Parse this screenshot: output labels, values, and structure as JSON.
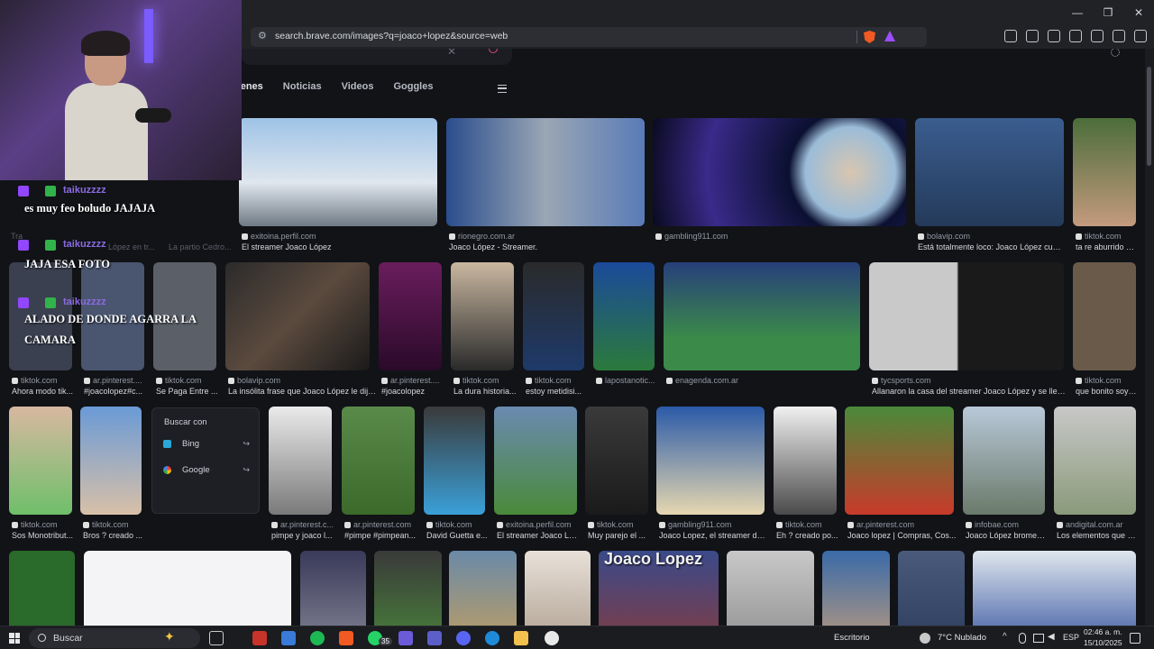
{
  "browser": {
    "url": "search.brave.com/images?q=joaco+lopez&source=web",
    "window_controls": [
      "—",
      "❐",
      "✕"
    ]
  },
  "search": {
    "tabs": [
      "genes",
      "Noticias",
      "Videos",
      "Goggles"
    ]
  },
  "results_row1": [
    {
      "source": "exitoina.perfil.com",
      "title": "El streamer Joaco López"
    },
    {
      "source": "rionegro.com.ar",
      "title": "Joaco López - Streamer."
    },
    {
      "source": "gambling911.com",
      "title": ""
    },
    {
      "source": "bolavip.com",
      "title": "Está totalmente loco: Joaco López cump..."
    },
    {
      "source": "tiktok.com",
      "title": "ta re aburrido E..."
    }
  ],
  "results_row2": [
    {
      "source": "tiktok.com",
      "title": "Ahora modo tik..."
    },
    {
      "source": "ar.pinterest....",
      "title": "#joacolopez#c..."
    },
    {
      "source": "tiktok.com",
      "title": "Se Paga Entre ..."
    },
    {
      "source": "bolavip.com",
      "title": "La insólita frase que Joaco López le dijo..."
    },
    {
      "source": "ar.pinterest....",
      "title": "#joacolopez"
    },
    {
      "source": "tiktok.com",
      "title": "La dura historia..."
    },
    {
      "source": "tiktok.com",
      "title": "estoy metidisi..."
    },
    {
      "source": "lapostanotic...",
      "title": ""
    },
    {
      "source": "enagenda.com.ar",
      "title": ""
    },
    {
      "source": "tycsports.com",
      "title": "Allanaron la casa del streamer Joaco López y se llevar..."
    },
    {
      "source": "tiktok.com",
      "title": "que bonito soy!..."
    }
  ],
  "results_row3": [
    {
      "source": "tiktok.com",
      "title": "Sos Monotribut..."
    },
    {
      "source": "tiktok.com",
      "title": "Bros ? creado ..."
    },
    {
      "source": "ar.pinterest.c...",
      "title": "pimpe y joaco l..."
    },
    {
      "source": "ar.pinterest.com",
      "title": "#pimpe #pimpean..."
    },
    {
      "source": "tiktok.com",
      "title": "David Guetta e..."
    },
    {
      "source": "exitoina.perfil.com",
      "title": "El streamer Joaco Ló..."
    },
    {
      "source": "tiktok.com",
      "title": "Muy parejo el ..."
    },
    {
      "source": "gambling911.com",
      "title": "Joaco Lopez, el streamer del..."
    },
    {
      "source": "tiktok.com",
      "title": "Eh ? creado po..."
    },
    {
      "source": "ar.pinterest.com",
      "title": "Joaco lopez | Compras, Cos..."
    },
    {
      "source": "infobae.com",
      "title": "Joaco López bromeó..."
    },
    {
      "source": "andigital.com.ar",
      "title": "Los elementos que s..."
    }
  ],
  "context_menu": {
    "header": "Buscar con",
    "items": [
      "Bing",
      "Google"
    ]
  },
  "image_text": {
    "joaco_banner": "Joaco Lopez"
  },
  "chat": {
    "messages": [
      {
        "user": "taikuzzzz",
        "text": "es muy feo boludo JAJAJA"
      },
      {
        "user": "taikuzzzz",
        "text": "JAJA ESA FOTO"
      },
      {
        "user": "taikuzzzz",
        "text": "ALADO DE DONDE AGARRA LA CAMARA"
      }
    ],
    "background_fragments": [
      "Tra",
      "López en tr...",
      "La partio Cedro..."
    ]
  },
  "taskbar": {
    "search_label": "Buscar",
    "whatsapp_badge": "35",
    "desktop_label": "Escritorio",
    "weather": "7°C  Nublado",
    "language": "ESP",
    "time": "02:46 a. m.",
    "date": "15/10/2025"
  },
  "colors": {
    "accent_brave": "#f15a22",
    "twitch_purple": "#9147ff",
    "page_bg": "#111317"
  }
}
